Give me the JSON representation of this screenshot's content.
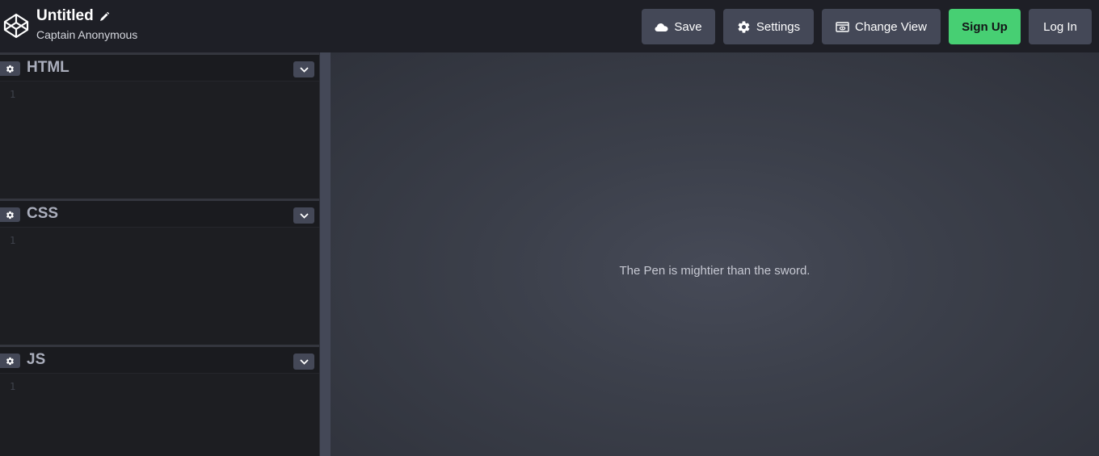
{
  "header": {
    "title": "Untitled",
    "author": "Captain Anonymous",
    "buttons": {
      "save": "Save",
      "settings": "Settings",
      "change_view": "Change View",
      "sign_up": "Sign Up",
      "log_in": "Log In"
    }
  },
  "editors": [
    {
      "label": "HTML",
      "line": "1"
    },
    {
      "label": "CSS",
      "line": "1"
    },
    {
      "label": "JS",
      "line": "1"
    }
  ],
  "preview": {
    "message": "The Pen is mightier than the sword."
  },
  "icons": {
    "logo": "codepen-logo-icon",
    "edit": "pencil-icon",
    "save": "cloud-icon",
    "settings": "gear-icon",
    "change_view": "view-icon",
    "collapse": "chevron-down-icon"
  },
  "colors": {
    "header_bg": "#1e1f26",
    "button_bg": "#444857",
    "signup_green": "#47cf73",
    "editor_bg": "#1d1e22",
    "preview_bg": "#3c404b"
  }
}
